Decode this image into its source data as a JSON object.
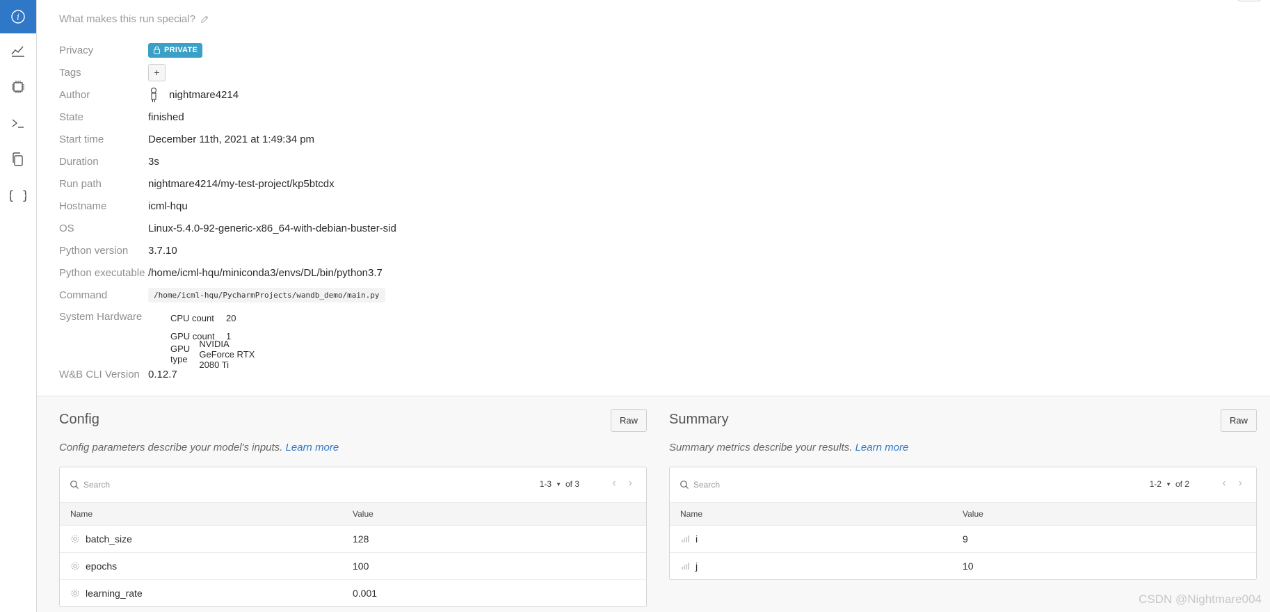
{
  "sidebar": {
    "items": [
      {
        "name": "overview",
        "icon": "info-icon",
        "active": true
      },
      {
        "name": "charts",
        "icon": "line-chart-icon"
      },
      {
        "name": "system",
        "icon": "chip-icon"
      },
      {
        "name": "logs",
        "icon": "terminal-icon"
      },
      {
        "name": "files",
        "icon": "files-icon"
      },
      {
        "name": "artifacts",
        "icon": "braces-icon"
      }
    ]
  },
  "overview": {
    "description_placeholder": "What makes this run special?",
    "rows": {
      "privacy": {
        "label": "Privacy",
        "value": "PRIVATE"
      },
      "tags": {
        "label": "Tags",
        "value": "+"
      },
      "author": {
        "label": "Author",
        "value": "nightmare4214"
      },
      "state": {
        "label": "State",
        "value": "finished"
      },
      "start_time": {
        "label": "Start time",
        "value": "December 11th, 2021 at 1:49:34 pm"
      },
      "duration": {
        "label": "Duration",
        "value": "3s"
      },
      "run_path": {
        "label": "Run path",
        "value": "nightmare4214/my-test-project/kp5btcdx"
      },
      "hostname": {
        "label": "Hostname",
        "value": "icml-hqu"
      },
      "os": {
        "label": "OS",
        "value": "Linux-5.4.0-92-generic-x86_64-with-debian-buster-sid"
      },
      "python_version": {
        "label": "Python version",
        "value": "3.7.10"
      },
      "python_executable": {
        "label": "Python executable",
        "value": "/home/icml-hqu/miniconda3/envs/DL/bin/python3.7"
      },
      "command": {
        "label": "Command",
        "value": "/home/icml-hqu/PycharmProjects/wandb_demo/main.py"
      },
      "system_hardware": {
        "label": "System Hardware",
        "items": [
          {
            "key": "CPU count",
            "value": "20"
          },
          {
            "key": "GPU count",
            "value": "1"
          },
          {
            "key": "GPU type",
            "value": "NVIDIA GeForce RTX 2080 Ti"
          }
        ]
      },
      "cli_version": {
        "label": "W&B CLI Version",
        "value": "0.12.7"
      }
    }
  },
  "config": {
    "title": "Config",
    "raw_label": "Raw",
    "description": "Config parameters describe your model's inputs.",
    "learn_more": "Learn more",
    "search_placeholder": "Search",
    "pager_range": "1-3",
    "pager_total": "of 3",
    "columns": {
      "name": "Name",
      "value": "Value"
    },
    "rows": [
      {
        "name": "batch_size",
        "value": "128"
      },
      {
        "name": "epochs",
        "value": "100"
      },
      {
        "name": "learning_rate",
        "value": "0.001"
      }
    ]
  },
  "summary": {
    "title": "Summary",
    "raw_label": "Raw",
    "description": "Summary metrics describe your results.",
    "learn_more": "Learn more",
    "search_placeholder": "Search",
    "pager_range": "1-2",
    "pager_total": "of 2",
    "columns": {
      "name": "Name",
      "value": "Value"
    },
    "rows": [
      {
        "name": "i",
        "value": "9"
      },
      {
        "name": "j",
        "value": "10"
      }
    ]
  },
  "watermark": "CSDN @Nightmare004",
  "colors": {
    "accent": "#2f78c8",
    "private_badge": "#3aa0c8"
  }
}
